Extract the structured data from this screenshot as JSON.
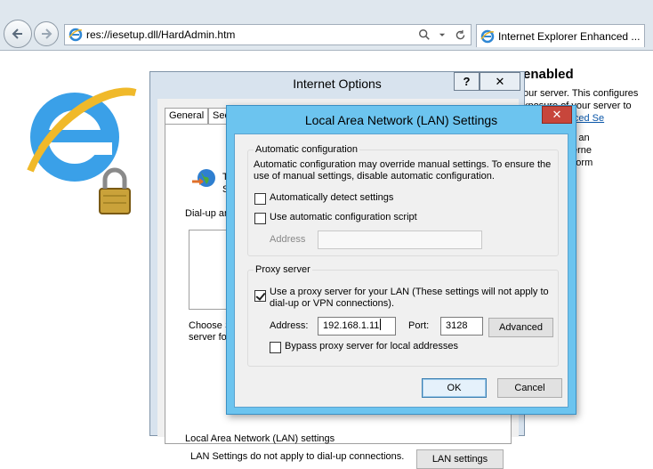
{
  "browser": {
    "address": "res://iesetup.dll/HardAdmin.htm",
    "tab_title": "Internet Explorer Enhanced ..."
  },
  "page": {
    "title": "enabled",
    "lines": [
      "our server. This configures",
      "xposure of your server to",
      "lorer Enhanced Se",
      "net Explorer an",
      "requires Interne",
      "For more inform"
    ]
  },
  "internet_options": {
    "title": "Internet Options",
    "help_label": "?",
    "close_label": "✕",
    "tabs": [
      "General",
      "Security"
    ],
    "setup_text_lines": [
      "To",
      "Se"
    ],
    "dialup_label": "Dial-up and",
    "choose_text_lines": [
      "Choose Se",
      "server for a"
    ],
    "lan_section_label": "Local Area Network (LAN) settings",
    "lan_section_text": "LAN Settings do not apply to dial-up connections.",
    "lan_settings_button": "LAN settings"
  },
  "lan_settings": {
    "title": "Local Area Network (LAN) Settings",
    "close_label": "✕",
    "automatic_configuration": {
      "legend": "Automatic configuration",
      "description_lines": [
        "Automatic configuration may override manual settings.  To ensure the",
        "use of manual settings, disable automatic configuration."
      ],
      "auto_detect_label": "Automatically detect settings",
      "auto_detect_checked": false,
      "use_script_label": "Use automatic configuration script",
      "use_script_checked": false,
      "address_label": "Address",
      "address_value": ""
    },
    "proxy_server": {
      "legend": "Proxy server",
      "use_proxy_label_lines": [
        "Use a proxy server for your LAN (These settings will not apply to",
        "dial-up or VPN connections)."
      ],
      "use_proxy_checked": true,
      "address_label": "Address:",
      "address_value": "192.168.1.11",
      "port_label": "Port:",
      "port_value": "3128",
      "advanced_button": "Advanced",
      "bypass_label": "Bypass proxy server for local addresses",
      "bypass_checked": false
    },
    "ok_button": "OK",
    "cancel_button": "Cancel"
  },
  "colors": {
    "lan_frame": "#6cc4ef",
    "close_red": "#c7463b",
    "link": "#0a56a8"
  }
}
